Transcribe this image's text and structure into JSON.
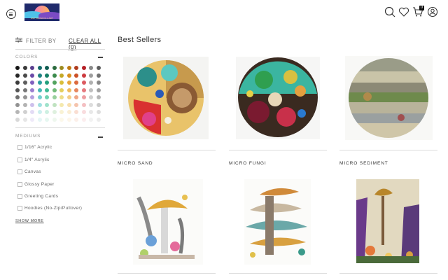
{
  "header": {
    "logo_text": "AMY DRISCOLL ART",
    "icons": [
      "menu-icon",
      "search-icon",
      "heart-icon",
      "cart-icon",
      "user-icon"
    ],
    "cart_count": "0"
  },
  "sidebar": {
    "filter_label": "FILTER BY",
    "clear_all_label": "CLEAR ALL (0)",
    "colors_title": "COLORS",
    "mediums_title": "MEDIUMS",
    "mediums": [
      "1/16\" Acrylic",
      "1/4\" Acrylic",
      "Canvas",
      "Glossy Paper",
      "Greeting Cards",
      "Hoodies (No-Zip/Pullover)"
    ],
    "show_more_label": "SHOW MORE",
    "swatch_colors": [
      [
        "#151515",
        "#3a3a3a",
        "#5a3e8f",
        "#166b6b",
        "#0f5d52",
        "#2c6b3e",
        "#9c8b1f",
        "#c07a12",
        "#b03c1d",
        "#b51f26",
        "#8a8a8a",
        "#5c5c5c"
      ],
      [
        "#272727",
        "#4a4a4a",
        "#6b4aa8",
        "#1e8282",
        "#168066",
        "#3b8a4b",
        "#c4a826",
        "#d99020",
        "#cc5128",
        "#cc3a3f",
        "#9e9e9e",
        "#727272"
      ],
      [
        "#3b3b3b",
        "#5e5e5e",
        "#8160bf",
        "#2aa0a0",
        "#22a07d",
        "#52a35e",
        "#d9be3a",
        "#e8a53a",
        "#dc6a3f",
        "#dc5a60",
        "#b0b0b0",
        "#888888"
      ],
      [
        "#535353",
        "#777777",
        "#9b7fd0",
        "#48b9b9",
        "#3fbb95",
        "#73bb7a",
        "#e5cf5c",
        "#efbb5e",
        "#e7875f",
        "#e67a7f",
        "#c0c0c0",
        "#a0a0a0"
      ],
      [
        "#6f6f6f",
        "#959595",
        "#b49fe0",
        "#73cfcf",
        "#6fd2b0",
        "#98d09c",
        "#eedd85",
        "#f4cd87",
        "#efa686",
        "#ee9ea2",
        "#cfcfcf",
        "#b5b5b5"
      ],
      [
        "#919191",
        "#b3b3b3",
        "#cdc0ec",
        "#a0e0e0",
        "#9fe2ca",
        "#bfe2c0",
        "#f4e8ad",
        "#f8dfae",
        "#f5c4ad",
        "#f4bfc2",
        "#dcdcdc",
        "#cacaca"
      ],
      [
        "#b5b5b5",
        "#d0d0d0",
        "#e3dbf5",
        "#ccefef",
        "#cdf0e2",
        "#def0de",
        "#f9f2d4",
        "#fbeed4",
        "#faded2",
        "#f9dcde",
        "#e8e8e8",
        "#dedede"
      ],
      [
        "#d8d8d8",
        "#e6e6e6",
        "#efeaf9",
        "#e5f6f6",
        "#e6f7f0",
        "#eef7ee",
        "#fcf8ea",
        "#fdf6ea",
        "#fcefe9",
        "#fcedee",
        "#f2f2f2",
        "#ececec"
      ]
    ]
  },
  "main": {
    "title": "Best Sellers",
    "products": [
      {
        "name": "MICRO SAND"
      },
      {
        "name": "MICRO FUNGI"
      },
      {
        "name": "MICRO SEDIMENT"
      },
      {
        "name": ""
      },
      {
        "name": ""
      },
      {
        "name": ""
      }
    ]
  },
  "colors": {
    "accent": "#111111",
    "divider": "#dddddd",
    "logo_bg": "#1f2a6b"
  }
}
